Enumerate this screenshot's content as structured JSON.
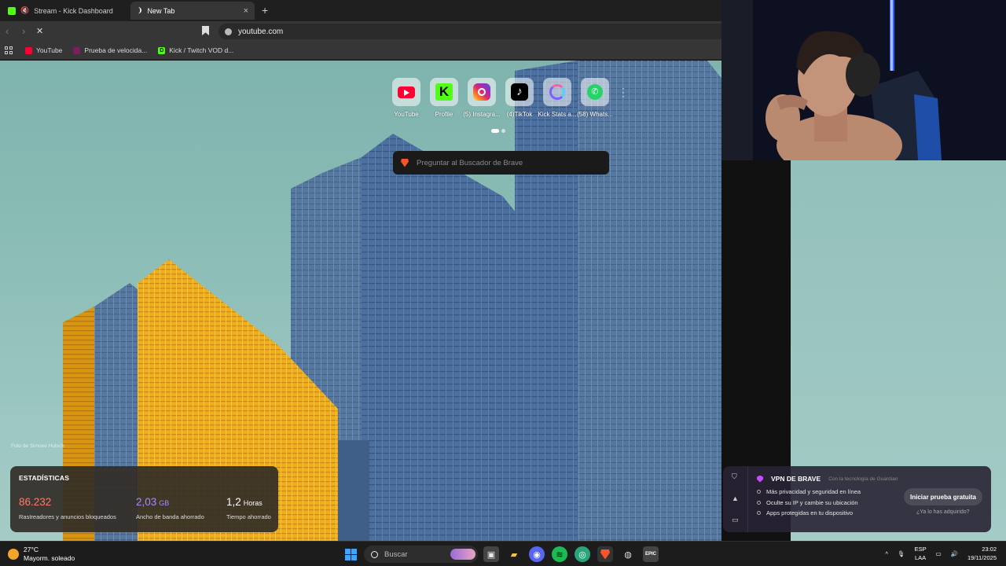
{
  "tabs": [
    {
      "title": "Stream - Kick Dashboard",
      "favicon_color": "#53fc18",
      "active": false
    },
    {
      "title": "New Tab",
      "favicon_color": "#888888",
      "active": true
    }
  ],
  "toolbar": {
    "url": "youtube.com"
  },
  "bookmarks": [
    {
      "label": "YouTube",
      "favicon_color": "#ff0033"
    },
    {
      "label": "Prueba de velocida...",
      "favicon_color": "#7a1f5c"
    },
    {
      "label": "Kick / Twitch VOD d...",
      "favicon_color": "#53fc18"
    }
  ],
  "shortcuts": [
    {
      "label": "YouTube",
      "icon": "youtube-icon",
      "color": "#ff0033"
    },
    {
      "label": "Profile",
      "icon": "kick-icon",
      "color": "#53fc18"
    },
    {
      "label": "(5) Instagra...",
      "icon": "instagram-icon",
      "color": "#d62976"
    },
    {
      "label": "(4)TikTok",
      "icon": "tiktok-icon",
      "color": "#000000"
    },
    {
      "label": "Kick Stats a...",
      "icon": "kick-stats-icon",
      "color": "#7b61ff"
    },
    {
      "label": "(58) Whats...",
      "icon": "whatsapp-icon",
      "color": "#25d366"
    }
  ],
  "search": {
    "placeholder": "Preguntar al Buscador de Brave"
  },
  "photo_credit": "Foto de Simone Hutsch",
  "stats": {
    "heading": "ESTADÍSTICAS",
    "items": [
      {
        "value": "86.232",
        "unit": "",
        "desc": "Rastreadores y anuncios bloqueados",
        "color": "#ff7a6e"
      },
      {
        "value": "2,03",
        "unit": "GB",
        "desc": "Ancho de banda ahorrado",
        "color": "#a08cff"
      },
      {
        "value": "1,2",
        "unit": "Horas",
        "desc": "Tiempo ahorrado",
        "color": "#ffffff"
      }
    ]
  },
  "vpn": {
    "title": "VPN DE BRAVE",
    "powered": "Con la tecnología de Guardian",
    "features": [
      "Más privacidad y seguridad en línea",
      "Oculte su IP y cambie su ubicación",
      "Apps protegidas en tu dispositivo"
    ],
    "cta": "Iniciar prueba gratuita",
    "owned": "¿Ya lo has adquirido?"
  },
  "taskbar": {
    "temp": "27°C",
    "weather": "Mayorm. soleado",
    "search": "Buscar",
    "lang1": "ESP",
    "lang2": "LAA",
    "time": "23:02",
    "date": "19/11/2025"
  },
  "colors": {
    "accent_orange": "#e9a81c",
    "building_blue": "#4a6fa0"
  }
}
